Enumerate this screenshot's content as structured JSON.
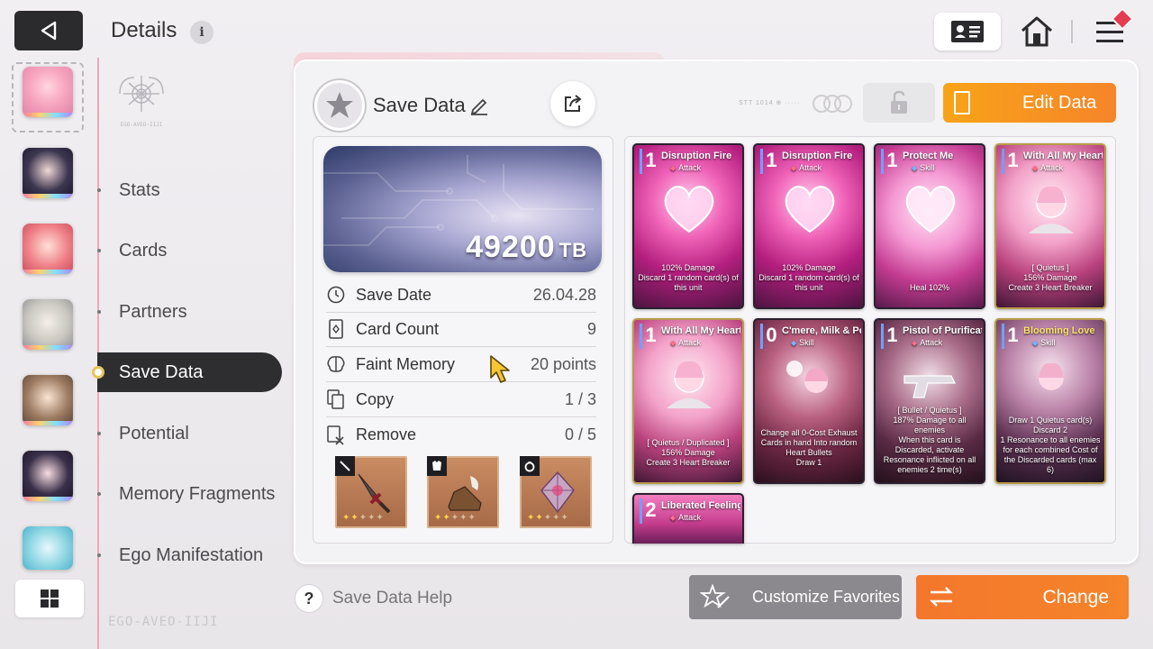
{
  "header": {
    "title": "Details",
    "info_icon": "info-icon",
    "back_icon": "back-arrow-icon",
    "profile_icon": "profile-card-icon",
    "home_icon": "home-icon",
    "menu_icon": "hamburger-menu-icon"
  },
  "sidebar": {
    "logo_text": "EGO-AVEO-IIJI",
    "bottom_logo_text": "EGO-AVEO-IIJI",
    "grid_icon": "grid-icon"
  },
  "nav": {
    "items": [
      {
        "label": "Stats"
      },
      {
        "label": "Cards"
      },
      {
        "label": "Partners"
      },
      {
        "label": "Save Data"
      },
      {
        "label": "Potential"
      },
      {
        "label": "Memory Fragments"
      },
      {
        "label": "Ego Manifestation"
      }
    ],
    "active_index": 3
  },
  "panel": {
    "title": "Save Data",
    "edit_button": "Edit Data",
    "tiny_text": "STT 1014 ⊕ ·····",
    "tb_value": "49200",
    "tb_unit": "TB"
  },
  "stats": [
    {
      "label": "Save Date",
      "value": "26.04.28",
      "icon": "clock-icon"
    },
    {
      "label": "Card Count",
      "value": "9",
      "icon": "card-icon"
    },
    {
      "label": "Faint Memory",
      "value": "20 points",
      "icon": "brain-icon"
    },
    {
      "label": "Copy",
      "value": "1 / 3",
      "icon": "copy-icon"
    },
    {
      "label": "Remove",
      "value": "0 / 5",
      "icon": "remove-icon"
    }
  ],
  "equipment": [
    {
      "slot": "weapon",
      "tag_icon": "sword-icon",
      "stars": 2
    },
    {
      "slot": "armor",
      "tag_icon": "armor-icon",
      "stars": 2
    },
    {
      "slot": "accessory",
      "tag_icon": "ring-icon",
      "stars": 2
    }
  ],
  "cards": [
    {
      "cost": "1",
      "name": "Disruption Fire",
      "type": "Attack",
      "desc": "102% Damage\nDiscard 1 random card(s) of this unit",
      "theme": "pink"
    },
    {
      "cost": "1",
      "name": "Disruption Fire",
      "type": "Attack",
      "desc": "102% Damage\nDiscard 1 random card(s) of this unit",
      "theme": "pink"
    },
    {
      "cost": "1",
      "name": "Protect Me",
      "type": "Skill",
      "desc": "Heal 102%",
      "theme": "pink"
    },
    {
      "cost": "1",
      "name": "With All My Heart!",
      "type": "Attack",
      "desc": "[ Quietus ]\n156% Damage\nCreate 3 Heart Breaker",
      "theme": "gold"
    },
    {
      "cost": "1",
      "name": "With All My Heart!",
      "type": "Attack",
      "desc": "[ Quietus / Duplicated ]\n156% Damage\nCreate 3 Heart Breaker",
      "theme": "gold"
    },
    {
      "cost": "0",
      "name": "C'mere, Milk & Pong!",
      "type": "Skill",
      "desc": "Change all 0-Cost Exhaust Cards in hand Into random Heart Bullets\nDraw 1",
      "theme": "dark"
    },
    {
      "cost": "1",
      "name": "Pistol of Purification",
      "type": "Attack",
      "desc": "[ Bullet / Quietus ]\n187% Damage to all enemies\nWhen this card is Discarded, activate Resonance inflicted on all enemies 2 time(s)",
      "theme": "dark"
    },
    {
      "cost": "1",
      "name": "Blooming Love",
      "type": "Skill",
      "desc": "Draw 1 Quietus card(s)\nDiscard 2\n1 Resonance to all enemies for each combined Cost of the Discarded cards (max 6)",
      "theme": "gold"
    },
    {
      "cost": "2",
      "name": "Liberated Feelings",
      "type": "Attack",
      "desc": "",
      "theme": "pink"
    }
  ],
  "footer": {
    "help_text": "Save Data Help",
    "favorites_button": "Customize Favorites",
    "change_button": "Change"
  },
  "colors": {
    "accent_orange": "#f6852a",
    "nav_active": "#2e2e31",
    "rail_border": "#f0a6b4"
  }
}
